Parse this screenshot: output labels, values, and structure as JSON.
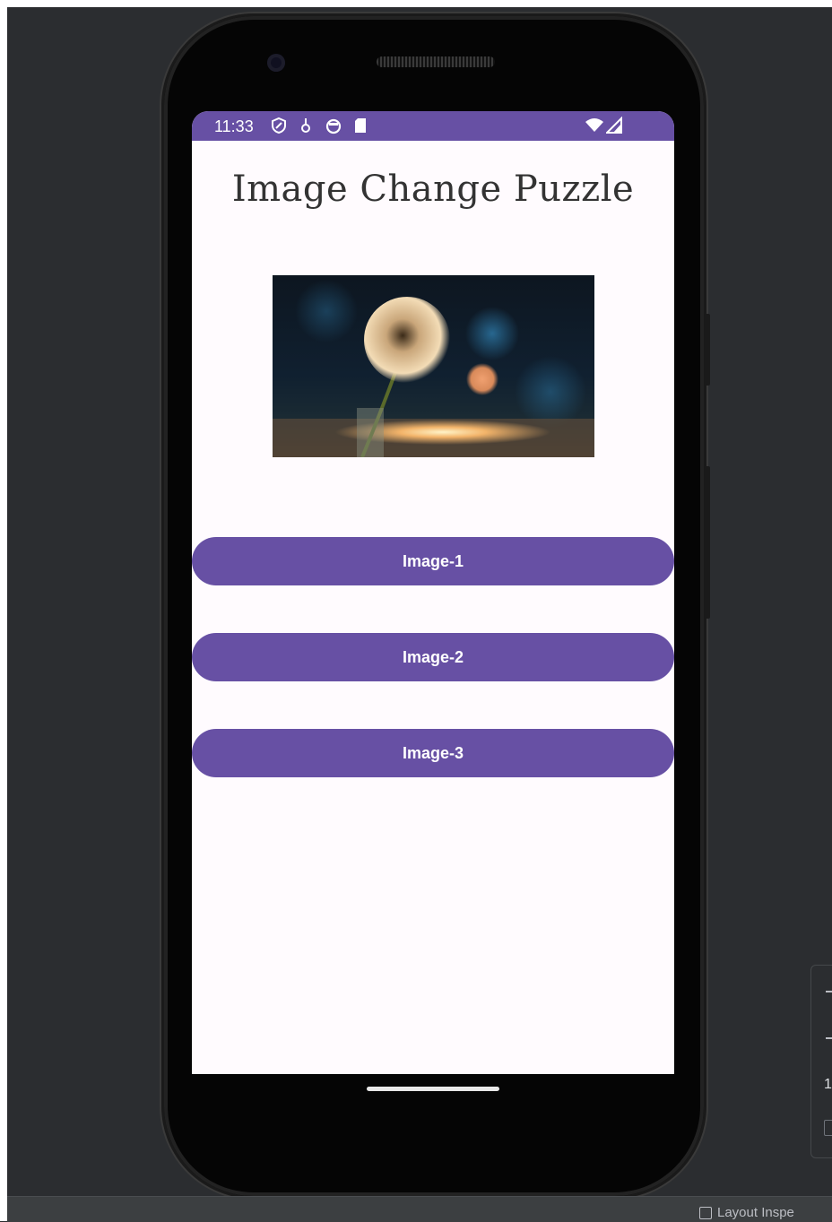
{
  "app": {
    "title": "Image Change Puzzle",
    "status_bar": {
      "time": "11:33",
      "left_icons": [
        "shield-icon",
        "download-icon",
        "circle-icon",
        "sd-card-icon"
      ],
      "right_icons": [
        "wifi-icon",
        "signal-icon"
      ]
    },
    "image": {
      "subject": "dandelion-in-bottle"
    },
    "buttons": [
      {
        "label": "Image-1"
      },
      {
        "label": "Image-2"
      },
      {
        "label": "Image-3"
      }
    ]
  },
  "ide": {
    "bottom_tool": "Layout Inspe",
    "side_number": "1"
  },
  "colors": {
    "accent": "#6750a4",
    "screen_bg": "#fffbfe",
    "ide_bg": "#2b2d30"
  }
}
